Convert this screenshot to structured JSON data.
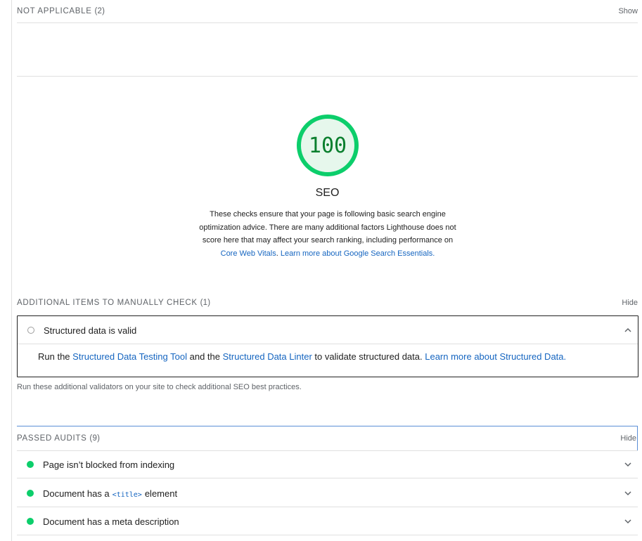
{
  "not_applicable": {
    "label": "NOT APPLICABLE",
    "count": "(2)",
    "toggle": "Show"
  },
  "seo": {
    "score": "100",
    "title": "SEO",
    "description": "These checks ensure that your page is following basic search engine optimization advice. There are many additional factors Lighthouse does not score here that may affect your search ranking, including performance on",
    "link_core_web_vitals": "Core Web Vitals",
    "link_sep": ". ",
    "link_search_essentials": "Learn more about Google Search Essentials",
    "end_period": "."
  },
  "manual_check": {
    "label": "ADDITIONAL ITEMS TO MANUALLY CHECK",
    "count": "(1)",
    "toggle": "Hide",
    "item_title": "Structured data is valid",
    "detail_part1": "Run the ",
    "detail_link1": "Structured Data Testing Tool",
    "detail_part2": " and the ",
    "detail_link2": "Structured Data Linter",
    "detail_part3": " to validate structured data. ",
    "detail_link3": "Learn more about Structured Data",
    "detail_part4": ".",
    "footnote": "Run these additional validators on your site to check additional SEO best practices."
  },
  "passed_audits": {
    "label": "PASSED AUDITS",
    "count": "(9)",
    "toggle": "Hide",
    "items": [
      {
        "text": "Page isn’t blocked from indexing"
      },
      {
        "text_before": "Document has a",
        "code": "<title>",
        "text_after": "element"
      },
      {
        "text": "Document has a meta description"
      }
    ]
  },
  "colors": {
    "pass_green": "#0cce6b",
    "score_text": "#0a7f2e",
    "link_blue": "#1565c0"
  }
}
